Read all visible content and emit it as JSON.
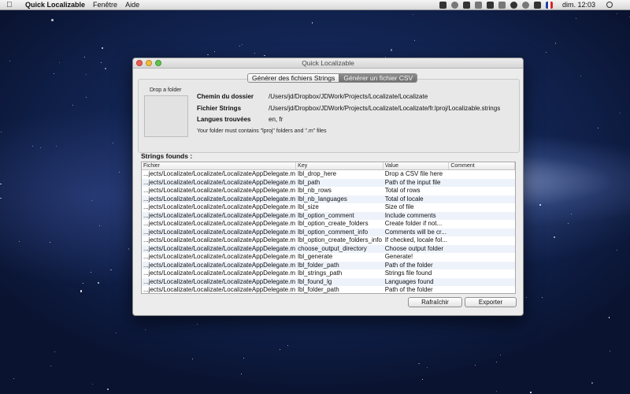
{
  "menubar": {
    "app_name": "Quick Localizable",
    "menus": [
      "Fenêtre",
      "Aide"
    ],
    "clock": "dim. 12:03"
  },
  "window": {
    "title": "Quick Localizable",
    "tabs": [
      "Générer des fichiers Strings",
      "Générer un fichier CSV"
    ],
    "active_tab": 1
  },
  "panel": {
    "drop_label": "Drop a folder",
    "folder_label": "Chemin du dossier",
    "folder_value": "/Users/jd/Dropbox/JDWork/Projects/Localizate/Localizate",
    "strings_label": "Fichier Strings",
    "strings_value": "/Users/jd/Dropbox/JDWork/Projects/Localizate/Localizate/fr.lproj/Localizable.strings",
    "languages_label": "Langues trouvées",
    "languages_value": "en, fr",
    "hint": "Your folder must contains \"lproj\" folders and \".m\" files"
  },
  "strings": {
    "title": "Strings founds :",
    "columns": [
      "Fichier",
      "Key",
      "Value",
      "Comment"
    ],
    "rows": [
      [
        "...jects/Localizate/Localizate/LocalizateAppDelegate.m",
        "lbl_drop_here",
        "Drop a CSV file here",
        ""
      ],
      [
        "...jects/Localizate/Localizate/LocalizateAppDelegate.m",
        "lbl_path",
        "Path of the input file",
        ""
      ],
      [
        "...jects/Localizate/Localizate/LocalizateAppDelegate.m",
        "lbl_nb_rows",
        "Total of rows",
        ""
      ],
      [
        "...jects/Localizate/Localizate/LocalizateAppDelegate.m",
        "lbl_nb_languages",
        "Total of locale",
        ""
      ],
      [
        "...jects/Localizate/Localizate/LocalizateAppDelegate.m",
        "lbl_size",
        "Size of file",
        ""
      ],
      [
        "...jects/Localizate/Localizate/LocalizateAppDelegate.m",
        "lbl_option_comment",
        " Include comments",
        ""
      ],
      [
        "...jects/Localizate/Localizate/LocalizateAppDelegate.m",
        "lbl_option_create_folders",
        " Create folder if not...",
        ""
      ],
      [
        "...jects/Localizate/Localizate/LocalizateAppDelegate.m",
        "lbl_option_comment_info",
        "Comments will be cr...",
        ""
      ],
      [
        "...jects/Localizate/Localizate/LocalizateAppDelegate.m",
        "lbl_option_create_folders_info",
        "If checked, locale fol...",
        ""
      ],
      [
        "...jects/Localizate/Localizate/LocalizateAppDelegate.m",
        "choose_output_directory",
        "Choose output folder",
        ""
      ],
      [
        "...jects/Localizate/Localizate/LocalizateAppDelegate.m",
        "lbl_generate",
        "Generate!",
        ""
      ],
      [
        "...jects/Localizate/Localizate/LocalizateAppDelegate.m",
        "lbl_folder_path",
        "Path of the folder",
        ""
      ],
      [
        "...jects/Localizate/Localizate/LocalizateAppDelegate.m",
        "lbl_strings_path",
        "Strings file found",
        ""
      ],
      [
        "...jects/Localizate/Localizate/LocalizateAppDelegate.m",
        "lbl_found_lg",
        "Languages found",
        ""
      ],
      [
        "...jects/Localizate/Localizate/LocalizateAppDelegate.m",
        "lbl_folder_path",
        "Path of the folder",
        ""
      ]
    ]
  },
  "buttons": {
    "refresh": "Rafraîchir",
    "export": "Exporter"
  },
  "menubar_icons": [
    "dropbox-icon",
    "sync-icon",
    "x-icon",
    "pen-icon",
    "airplay-icon",
    "battery-icon",
    "history-icon",
    "wifi-icon",
    "volume-icon",
    "flag-fr-icon",
    "search-icon"
  ]
}
